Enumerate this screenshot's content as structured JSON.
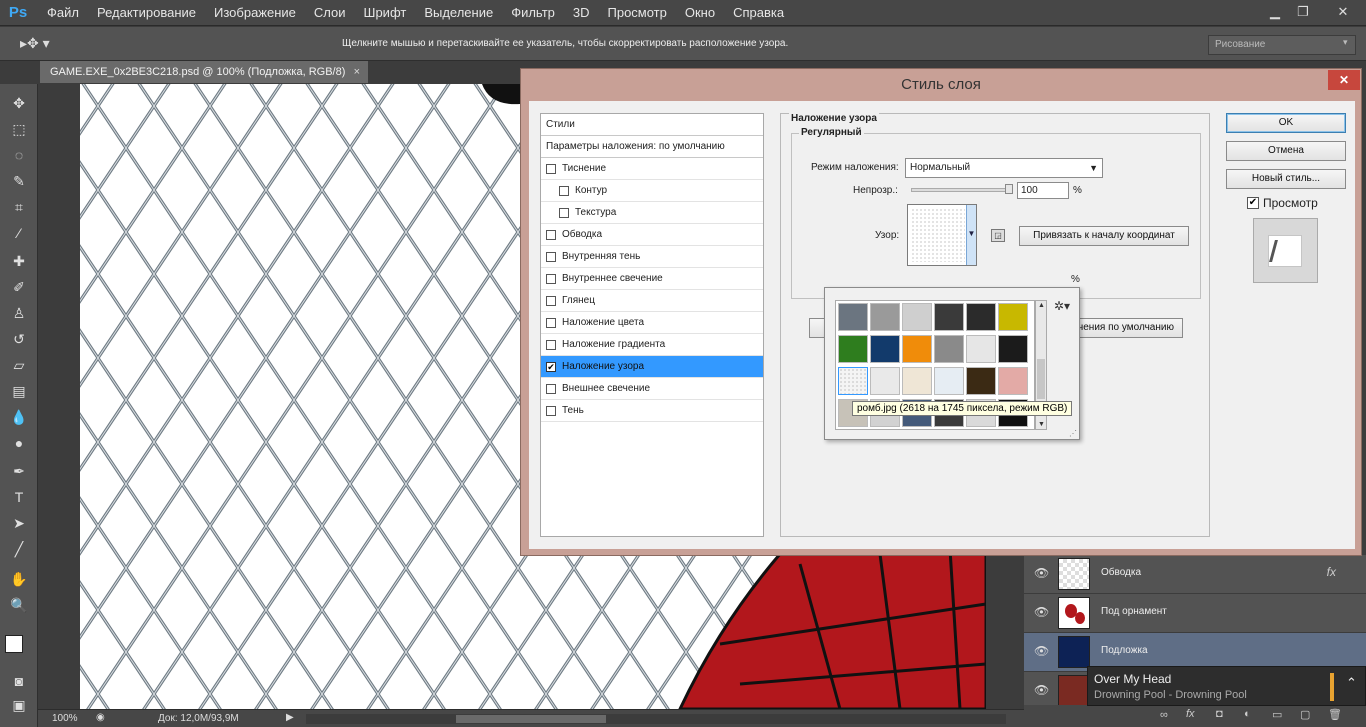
{
  "app": {
    "logo": "Ps"
  },
  "menu": [
    "Файл",
    "Редактирование",
    "Изображение",
    "Слои",
    "Шрифт",
    "Выделение",
    "Фильтр",
    "3D",
    "Просмотр",
    "Окно",
    "Справка"
  ],
  "options_bar": {
    "hint": "Щелкните мышью и перетаскивайте ее указатель, чтобы скорректировать расположение узора.",
    "workspace": "Рисование"
  },
  "document": {
    "tab_title": "GAME.EXE_0x2BE3C218.psd @ 100% (Подложка, RGB/8)"
  },
  "status": {
    "zoom": "100%",
    "doc_size": "Док: 12,0M/93,9M"
  },
  "dialog": {
    "title": "Стиль слоя",
    "styles_header": "Стили",
    "blend_default": "Параметры наложения: по умолчанию",
    "effects": [
      {
        "label": "Тиснение",
        "checked": false,
        "indent": false
      },
      {
        "label": "Контур",
        "checked": false,
        "indent": true
      },
      {
        "label": "Текстура",
        "checked": false,
        "indent": true
      },
      {
        "label": "Обводка",
        "checked": false,
        "indent": false
      },
      {
        "label": "Внутренняя тень",
        "checked": false,
        "indent": false
      },
      {
        "label": "Внутреннее свечение",
        "checked": false,
        "indent": false
      },
      {
        "label": "Глянец",
        "checked": false,
        "indent": false
      },
      {
        "label": "Наложение цвета",
        "checked": false,
        "indent": false
      },
      {
        "label": "Наложение градиента",
        "checked": false,
        "indent": false
      },
      {
        "label": "Наложение узора",
        "checked": true,
        "indent": false,
        "active": true
      },
      {
        "label": "Внешнее свечение",
        "checked": false,
        "indent": false
      },
      {
        "label": "Тень",
        "checked": false,
        "indent": false
      }
    ],
    "section_title": "Наложение узора",
    "group_title": "Регулярный",
    "blend_mode_label": "Режим наложения:",
    "blend_mode_value": "Нормальный",
    "opacity_label": "Непрозр.:",
    "opacity_value": "100",
    "opacity_value_fraction": 1.0,
    "percent": "%",
    "percent2": "%",
    "pattern_label": "Узор:",
    "snap_button": "Привязать к началу координат",
    "default_button": "чения по умолчанию",
    "tooltip": "ромб.jpg (2618 на 1745 пиксела, режим RGB)",
    "ok": "OK",
    "cancel": "Отмена",
    "new_style": "Новый стиль...",
    "preview_label": "Просмотр",
    "preview_checked": true,
    "pattern_colors": [
      [
        "#6b7580",
        "#9a9a9a",
        "#cfcfcf",
        "#3a3a3a",
        "#2b2b2b",
        "#c8b800"
      ],
      [
        "#2e7d1e",
        "#123a6b",
        "#f08c0a",
        "#8a8a8a",
        "#e6e6e6",
        "#1b1b1b"
      ],
      [
        "#f4f4f4",
        "#e9e9e9",
        "#efe6d6",
        "#e6edf3",
        "#3b2a14",
        "#e3aaa6"
      ],
      [
        "#c7c2b8",
        "#d2d2d2",
        "#445a7a",
        "#3a3a3a",
        "#dadada",
        "#111111"
      ]
    ]
  },
  "layers": [
    {
      "name": "Обводка",
      "fx": "fx",
      "thumb": "#ffffff",
      "selected": false
    },
    {
      "name": "Под орнамент",
      "fx": "",
      "thumb": "#ffffff",
      "selected": false
    },
    {
      "name": "Подложка",
      "fx": "",
      "thumb": "#0d2255",
      "selected": true
    }
  ],
  "notification": {
    "title": "Over My Head",
    "subtitle": "Drowning Pool - Drowning Pool"
  }
}
